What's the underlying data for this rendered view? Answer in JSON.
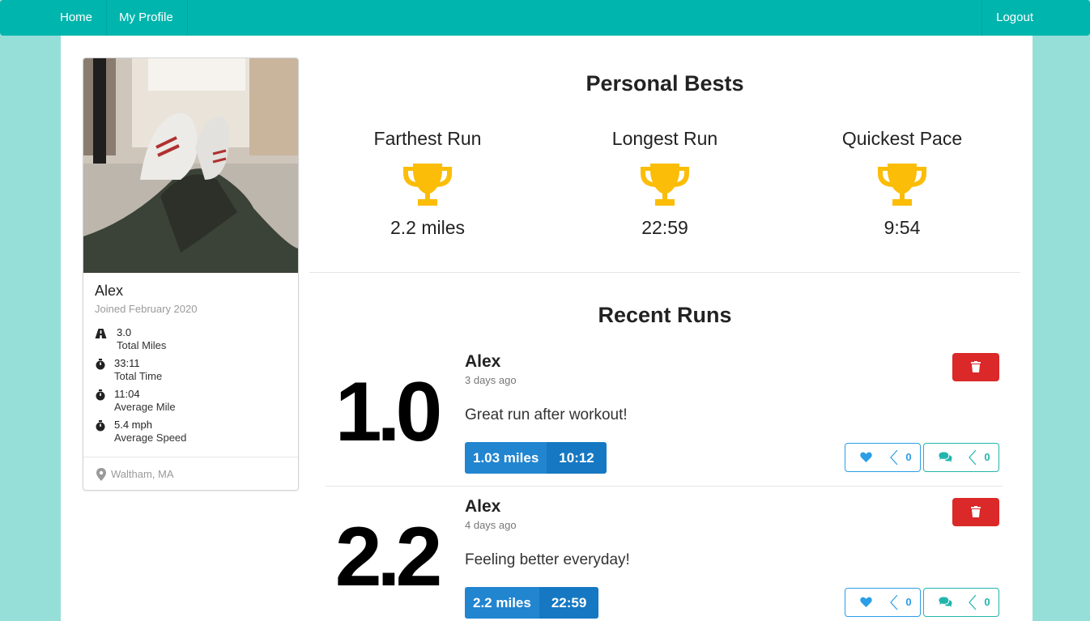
{
  "nav": {
    "home": "Home",
    "profile": "My Profile",
    "logout": "Logout"
  },
  "profile": {
    "name": "Alex",
    "joined": "Joined February 2020",
    "location": "Waltham, MA",
    "stats": [
      {
        "icon": "road-icon",
        "value": "3.0",
        "label": "Total Miles"
      },
      {
        "icon": "stopwatch-icon",
        "value": "33:11",
        "label": "Total Time"
      },
      {
        "icon": "stopwatch-icon",
        "value": "11:04",
        "label": "Average Mile"
      },
      {
        "icon": "stopwatch-icon",
        "value": "5.4 mph",
        "label": "Average Speed"
      }
    ]
  },
  "personal_bests": {
    "title": "Personal Bests",
    "items": [
      {
        "label": "Farthest Run",
        "value": "2.2 miles"
      },
      {
        "label": "Longest Run",
        "value": "22:59"
      },
      {
        "label": "Quickest Pace",
        "value": "9:54"
      }
    ]
  },
  "recent_runs": {
    "title": "Recent Runs",
    "items": [
      {
        "distance": "1.0",
        "user": "Alex",
        "date": "3 days ago",
        "note": "Great run after workout!",
        "miles": "1.03 miles",
        "time": "10:12",
        "likes": "0",
        "comments": "0"
      },
      {
        "distance": "2.2",
        "user": "Alex",
        "date": "4 days ago",
        "note": "Feeling better everyday!",
        "miles": "2.2 miles",
        "time": "22:59",
        "likes": "0",
        "comments": "0"
      }
    ]
  },
  "colors": {
    "nav": "#00b5ad",
    "page_bg": "#96ded8",
    "trophy": "#fbbd08",
    "delete": "#db2828",
    "label_blue": "#2185d0"
  }
}
